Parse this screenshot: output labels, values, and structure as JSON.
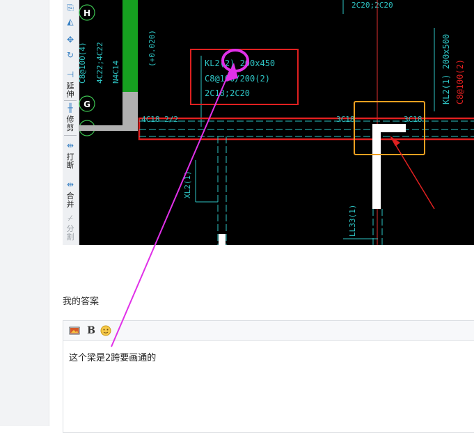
{
  "cad": {
    "toolbar": {
      "labels": [
        "延",
        "伸",
        "修",
        "剪",
        "打",
        "断",
        "合",
        "并",
        "分",
        "割"
      ]
    },
    "axis_labels": [
      "H",
      "G"
    ],
    "top_text": "2C20;2C20",
    "left_vertical_texts": [
      "C8@100(4)",
      "4C22;4C22",
      "N4C14"
    ],
    "elevation": "(+0.020)",
    "beam_annotation": {
      "line1": "KL2(2) 200x450",
      "line2": "C8@100/200(2)",
      "line3": "2C18;2C20"
    },
    "beam_texts": [
      "4C18 2/2",
      "3C18",
      "3C18"
    ],
    "right_texts": {
      "line1": "KL2(1) 200x500",
      "line2": "C8@100(2)"
    },
    "xl_label": "XL2(1)",
    "ll_label": "LL33(1)",
    "colors": {
      "background": "#000000",
      "grid_cyan": "#2ec4c4",
      "axis_red": "#e03030",
      "highlight_red": "#e02020",
      "highlight_orange": "#f0a020",
      "magenta": "#e030e8",
      "column_green": "#16a020",
      "wall_gray": "#b0b0b0",
      "axis_circle_green": "#3cc050"
    }
  },
  "answer": {
    "label": "我的答案",
    "content": "这个梁是2跨要画通的"
  },
  "editor": {
    "toolbar_icons": [
      "image-icon",
      "bold-icon",
      "emoji-icon"
    ],
    "bold_label": "B"
  }
}
